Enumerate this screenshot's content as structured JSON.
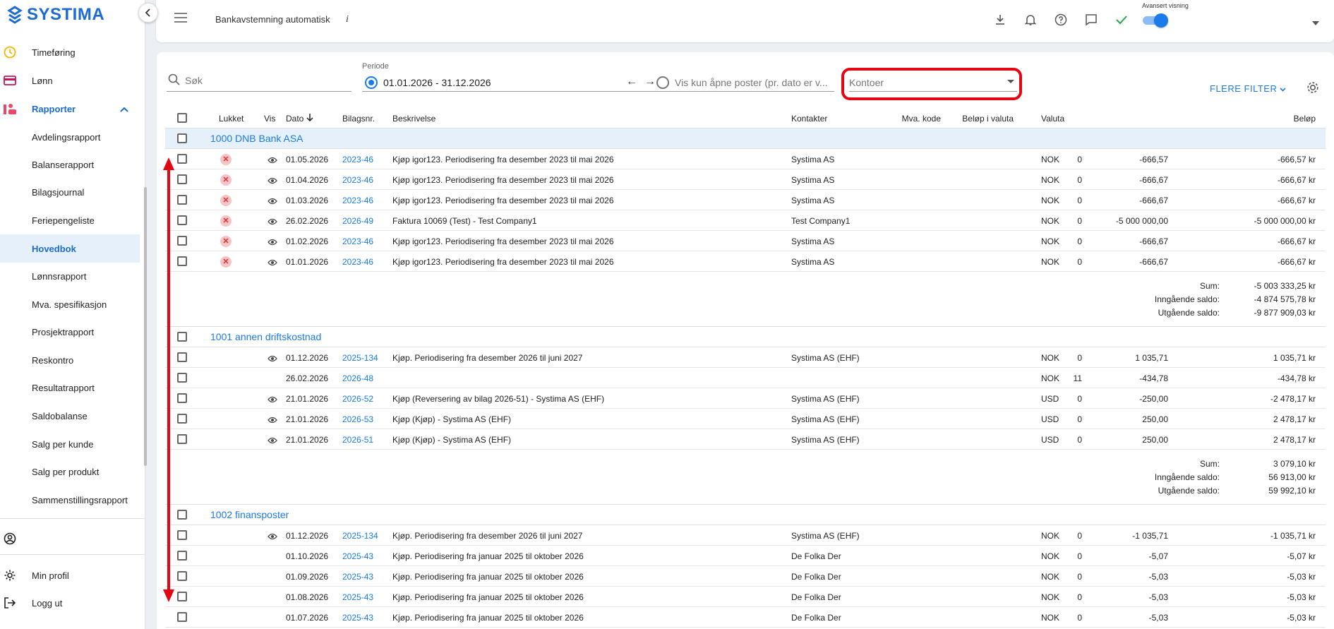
{
  "app": {
    "logo": "SYSTIMA"
  },
  "sidebar": {
    "items": [
      {
        "label": "Timeføring",
        "icon": "clock-icon"
      },
      {
        "label": "Lønn",
        "icon": "wallet-icon"
      },
      {
        "label": "Rapporter",
        "icon": "reports-icon"
      },
      {
        "label": "Avdelingsrapport"
      },
      {
        "label": "Balanserapport"
      },
      {
        "label": "Bilagsjournal"
      },
      {
        "label": "Feriepengeliste"
      },
      {
        "label": "Hovedbok"
      },
      {
        "label": "Lønnsrapport"
      },
      {
        "label": "Mva. spesifikasjon"
      },
      {
        "label": "Prosjektrapport"
      },
      {
        "label": "Reskontro"
      },
      {
        "label": "Resultatrapport"
      },
      {
        "label": "Saldobalanse"
      },
      {
        "label": "Salg per kunde"
      },
      {
        "label": "Salg per produkt"
      },
      {
        "label": "Sammenstillingsrapport"
      }
    ],
    "bottom": [
      {
        "label": "Min profil"
      },
      {
        "label": "Logg ut"
      }
    ]
  },
  "topbar": {
    "title": "Bankavstemning automatisk",
    "info": "i",
    "advanced_label": "Avansert visning",
    "advanced_on": true,
    "accent": "#1b7be8"
  },
  "filters": {
    "search_placeholder": "Søk",
    "periode_label": "Periode",
    "periode_value": "01.01.2026 - 31.12.2026",
    "open_posts_label": "Vis kun åpne poster (pr. dato er v...",
    "kontoer_placeholder": "Kontoer",
    "more_filters": "FLERE FILTER"
  },
  "table": {
    "headers": {
      "lukket": "Lukket",
      "vis": "Vis",
      "dato": "Dato",
      "bilagsnr": "Bilagsnr.",
      "beskrivelse": "Beskrivelse",
      "kontakter": "Kontakter",
      "mva": "Mva. kode",
      "belop_valuta": "Beløp i valuta",
      "valuta": "Valuta",
      "belop": "Beløp"
    },
    "groups": [
      {
        "name": "1000 DNB Bank ASA",
        "rows": [
          {
            "closed": true,
            "vis": true,
            "dato": "01.05.2026",
            "bilag": "2023-46",
            "beskrivelse": "Kjøp igor123. Periodisering fra desember 2023 til mai 2026",
            "kontakt": "Systima AS",
            "mva": "0",
            "belop_valuta": "-666,57",
            "valuta": "NOK",
            "belop": "-666,57 kr"
          },
          {
            "closed": true,
            "vis": true,
            "dato": "01.04.2026",
            "bilag": "2023-46",
            "beskrivelse": "Kjøp igor123. Periodisering fra desember 2023 til mai 2026",
            "kontakt": "Systima AS",
            "mva": "0",
            "belop_valuta": "-666,67",
            "valuta": "NOK",
            "belop": "-666,67 kr"
          },
          {
            "closed": true,
            "vis": true,
            "dato": "01.03.2026",
            "bilag": "2023-46",
            "beskrivelse": "Kjøp igor123. Periodisering fra desember 2023 til mai 2026",
            "kontakt": "Systima AS",
            "mva": "0",
            "belop_valuta": "-666,67",
            "valuta": "NOK",
            "belop": "-666,67 kr"
          },
          {
            "closed": true,
            "vis": true,
            "dato": "26.02.2026",
            "bilag": "2026-49",
            "beskrivelse": "Faktura 10069 (Test) - Test Company1",
            "kontakt": "Test Company1",
            "mva": "0",
            "belop_valuta": "-5 000 000,00",
            "valuta": "NOK",
            "belop": "-5 000 000,00 kr"
          },
          {
            "closed": true,
            "vis": true,
            "dato": "01.02.2026",
            "bilag": "2023-46",
            "beskrivelse": "Kjøp igor123. Periodisering fra desember 2023 til mai 2026",
            "kontakt": "Systima AS",
            "mva": "0",
            "belop_valuta": "-666,67",
            "valuta": "NOK",
            "belop": "-666,67 kr"
          },
          {
            "closed": true,
            "vis": true,
            "dato": "01.01.2026",
            "bilag": "2023-46",
            "beskrivelse": "Kjøp igor123. Periodisering fra desember 2023 til mai 2026",
            "kontakt": "Systima AS",
            "mva": "0",
            "belop_valuta": "-666,67",
            "valuta": "NOK",
            "belop": "-666,67 kr"
          }
        ],
        "summary": [
          {
            "label": "Sum:",
            "value": "-5 003 333,25 kr"
          },
          {
            "label": "Inngående saldo:",
            "value": "-4 874 575,78 kr"
          },
          {
            "label": "Utgående saldo:",
            "value": "-9 877 909,03 kr"
          }
        ]
      },
      {
        "name": "1001 annen driftskostnad",
        "rows": [
          {
            "closed": false,
            "vis": true,
            "dato": "01.12.2026",
            "bilag": "2025-134",
            "beskrivelse": "Kjøp. Periodisering fra desember 2026 til juni 2027",
            "kontakt": "Systima AS (EHF)",
            "mva": "0",
            "belop_valuta": "1 035,71",
            "valuta": "NOK",
            "belop": "1 035,71 kr"
          },
          {
            "closed": false,
            "vis": false,
            "dato": "26.02.2026",
            "bilag": "2026-48",
            "beskrivelse": "",
            "kontakt": "",
            "mva": "11",
            "belop_valuta": "-434,78",
            "valuta": "NOK",
            "belop": "-434,78 kr"
          },
          {
            "closed": false,
            "vis": true,
            "dato": "21.01.2026",
            "bilag": "2026-52",
            "beskrivelse": "Kjøp (Reversering av bilag 2026-51) - Systima AS (EHF)",
            "kontakt": "Systima AS (EHF)",
            "mva": "0",
            "belop_valuta": "-250,00",
            "valuta": "USD",
            "belop": "-2 478,17 kr"
          },
          {
            "closed": false,
            "vis": true,
            "dato": "21.01.2026",
            "bilag": "2026-53",
            "beskrivelse": "Kjøp (Kjøp) - Systima AS (EHF)",
            "kontakt": "Systima AS (EHF)",
            "mva": "0",
            "belop_valuta": "250,00",
            "valuta": "USD",
            "belop": "2 478,17 kr"
          },
          {
            "closed": false,
            "vis": true,
            "dato": "21.01.2026",
            "bilag": "2026-51",
            "beskrivelse": "Kjøp (Kjøp) - Systima AS (EHF)",
            "kontakt": "Systima AS (EHF)",
            "mva": "0",
            "belop_valuta": "250,00",
            "valuta": "USD",
            "belop": "2 478,17 kr"
          }
        ],
        "summary": [
          {
            "label": "Sum:",
            "value": "3 079,10 kr"
          },
          {
            "label": "Inngående saldo:",
            "value": "56 913,00 kr"
          },
          {
            "label": "Utgående saldo:",
            "value": "59 992,10 kr"
          }
        ]
      },
      {
        "name": "1002 finansposter",
        "rows": [
          {
            "closed": false,
            "vis": true,
            "dato": "01.12.2026",
            "bilag": "2025-134",
            "beskrivelse": "Kjøp. Periodisering fra desember 2026 til juni 2027",
            "kontakt": "Systima AS (EHF)",
            "mva": "0",
            "belop_valuta": "-1 035,71",
            "valuta": "NOK",
            "belop": "-1 035,71 kr"
          },
          {
            "closed": false,
            "vis": false,
            "dato": "01.10.2026",
            "bilag": "2025-43",
            "beskrivelse": "Kjøp. Periodisering fra januar 2025 til oktober 2026",
            "kontakt": "De Folka Der",
            "mva": "0",
            "belop_valuta": "-5,07",
            "valuta": "NOK",
            "belop": "-5,07 kr"
          },
          {
            "closed": false,
            "vis": false,
            "dato": "01.09.2026",
            "bilag": "2025-43",
            "beskrivelse": "Kjøp. Periodisering fra januar 2025 til oktober 2026",
            "kontakt": "De Folka Der",
            "mva": "0",
            "belop_valuta": "-5,03",
            "valuta": "NOK",
            "belop": "-5,03 kr"
          },
          {
            "closed": false,
            "vis": false,
            "dato": "01.08.2026",
            "bilag": "2025-43",
            "beskrivelse": "Kjøp. Periodisering fra januar 2025 til oktober 2026",
            "kontakt": "De Folka Der",
            "mva": "0",
            "belop_valuta": "-5,03",
            "valuta": "NOK",
            "belop": "-5,03 kr"
          },
          {
            "closed": false,
            "vis": false,
            "dato": "01.07.2026",
            "bilag": "2025-43",
            "beskrivelse": "Kjøp. Periodisering fra januar 2025 til oktober 2026",
            "kontakt": "De Folka Der",
            "mva": "0",
            "belop_valuta": "-5,03",
            "valuta": "NOK",
            "belop": "-5,03 kr"
          }
        ]
      }
    ]
  }
}
